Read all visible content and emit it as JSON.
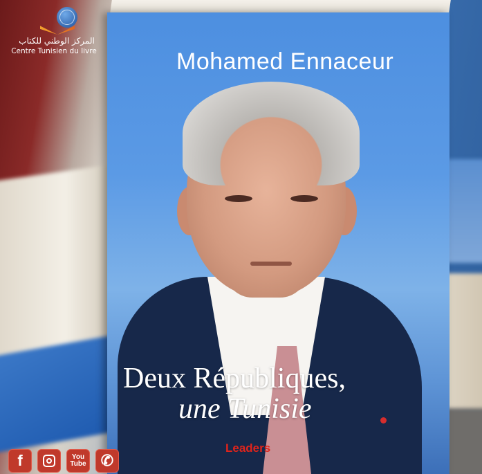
{
  "logo": {
    "arabic_text": "المركز الوطني للكتاب",
    "french_text": "Centre Tunisien du livre"
  },
  "book": {
    "author": "Mohamed Ennaceur",
    "title_line1": "Deux Républiques,",
    "title_line2": "une Tunisie",
    "publisher": "Leaders"
  },
  "social_icons": [
    {
      "icon": "facebook-icon",
      "label": "f"
    },
    {
      "icon": "instagram-icon",
      "label": ""
    },
    {
      "icon": "youtube-icon",
      "label_top": "You",
      "label_bottom": "Tube"
    },
    {
      "icon": "phone-icon",
      "label": "✆"
    }
  ],
  "colors": {
    "cover_blue": "#4d8fe0",
    "publisher_red": "#e0241b",
    "social_red": "#c0392b"
  }
}
